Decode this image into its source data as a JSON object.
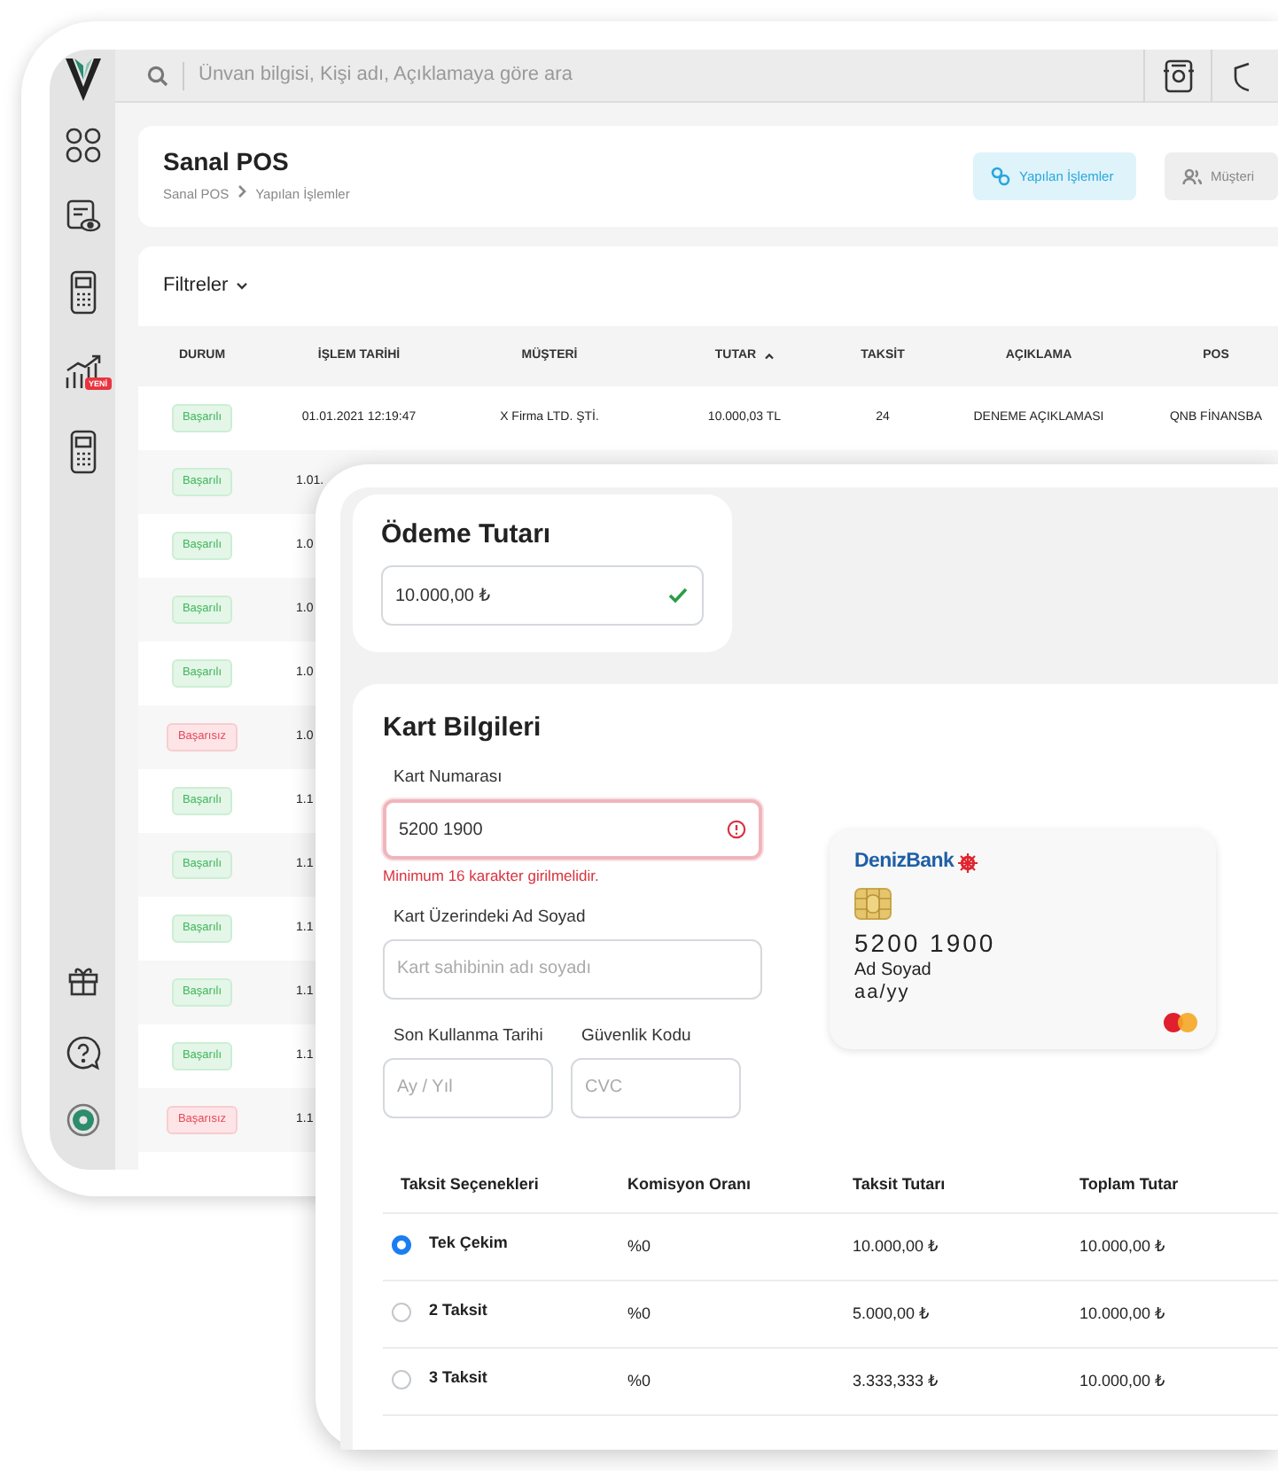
{
  "search": {
    "placeholder": "Ünvan bilgisi, Kişi adı, Açıklamaya göre ara"
  },
  "sidebar_badge": "YENİ",
  "page": {
    "title": "Sanal POS",
    "breadcrumb": [
      "Sanal POS",
      "Yapılan İşlemler"
    ],
    "actions": [
      {
        "label": "Yapılan İşlemler",
        "selected": true
      },
      {
        "label": "Müşteri",
        "selected": false
      }
    ]
  },
  "filters": {
    "label": "Filtreler"
  },
  "table": {
    "columns": [
      {
        "label": "DURUM",
        "sorted": false
      },
      {
        "label": "İŞLEM TARİHİ",
        "sorted": false
      },
      {
        "label": "MÜŞTERİ",
        "sorted": false
      },
      {
        "label": "TUTAR",
        "sorted": true
      },
      {
        "label": "TAKSİT",
        "sorted": false
      },
      {
        "label": "AÇIKLAMA",
        "sorted": false
      },
      {
        "label": "POS",
        "sorted": false
      }
    ],
    "rows": [
      {
        "kind": "success",
        "cells": [
          "Başarılı",
          "01.01.2021 12:19:47",
          "X Firma LTD. ŞTİ.",
          "10.000,03 TL",
          "24",
          "DENEME AÇIKLAMASI",
          "QNB FİNANSBA"
        ]
      },
      {
        "kind": "success",
        "cells": [
          "Başarılı",
          "1.01."
        ]
      },
      {
        "kind": "success",
        "cells": [
          "Başarılı",
          "1.0"
        ]
      },
      {
        "kind": "success",
        "cells": [
          "Başarılı",
          "1.0"
        ]
      },
      {
        "kind": "success",
        "cells": [
          "Başarılı",
          "1.0"
        ]
      },
      {
        "kind": "failure",
        "cells": [
          "Başarısız",
          "1.0"
        ]
      },
      {
        "kind": "success",
        "cells": [
          "Başarılı",
          "1.1"
        ]
      },
      {
        "kind": "success",
        "cells": [
          "Başarılı",
          "1.1"
        ]
      },
      {
        "kind": "success",
        "cells": [
          "Başarılı",
          "1.1"
        ]
      },
      {
        "kind": "success",
        "cells": [
          "Başarılı",
          "1.1"
        ]
      },
      {
        "kind": "success",
        "cells": [
          "Başarılı",
          "1.1"
        ]
      },
      {
        "kind": "failure",
        "cells": [
          "Başarısız",
          "1.1"
        ]
      }
    ]
  },
  "payment": {
    "title": "Ödeme Tutarı",
    "amount": "10.000,00 ₺",
    "valid": true
  },
  "card_form": {
    "title": "Kart Bilgileri",
    "number": {
      "label": "Kart Numarası",
      "value": "5200 1900",
      "invalid": true,
      "error": "Minimum 16 karakter girilmelidir."
    },
    "holder": {
      "label": "Kart Üzerindeki Ad Soyad",
      "placeholder": "Kart sahibinin adı soyadı"
    },
    "expiry": {
      "label": "Son Kullanma Tarihi",
      "placeholder": "Ay / Yıl"
    },
    "cvc": {
      "label": "Güvenlik Kodu",
      "placeholder": "CVC"
    }
  },
  "card_preview": {
    "bank": "DenizBank",
    "number": "5200 1900",
    "name": "Ad Soyad",
    "expiry": "aa/yy"
  },
  "installments": {
    "columns": [
      "Taksit Seçenekleri",
      "Komisyon Oranı",
      "Taksit Tutarı",
      "Toplam Tutar"
    ],
    "rows": [
      {
        "label": "Tek Çekim",
        "selected": true,
        "rate": "%0",
        "installment": "10.000,00 ₺",
        "total": "10.000,00 ₺"
      },
      {
        "label": "2 Taksit",
        "selected": false,
        "rate": "%0",
        "installment": "5.000,00 ₺",
        "total": "10.000,00 ₺"
      },
      {
        "label": "3 Taksit",
        "selected": false,
        "rate": "%0",
        "installment": "3.333,333 ₺",
        "total": "10.000,00 ₺"
      }
    ]
  }
}
